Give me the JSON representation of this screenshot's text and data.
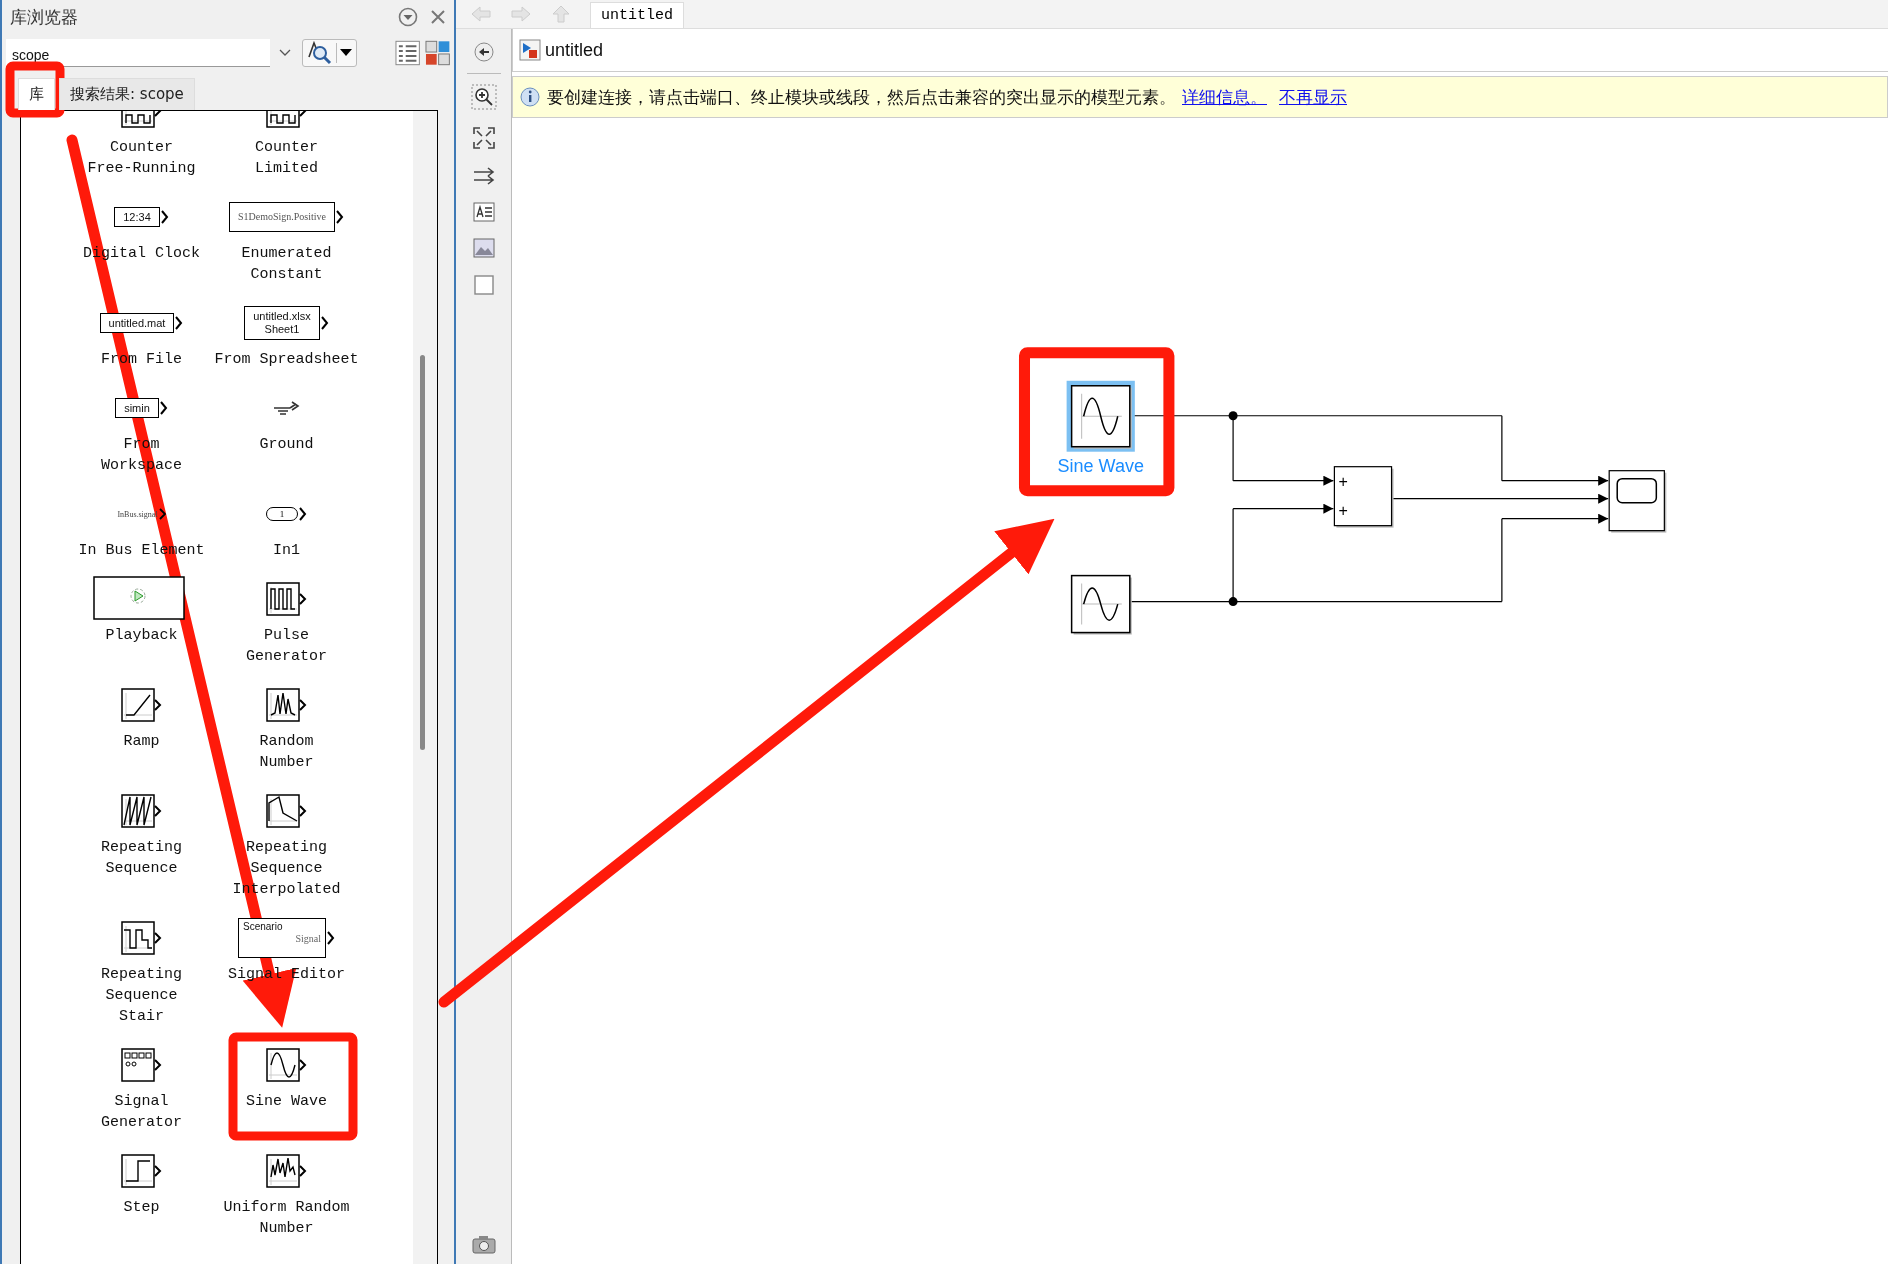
{
  "library_browser": {
    "title": "库浏览器",
    "search": {
      "value": "scope"
    },
    "tabs": [
      {
        "label": "库",
        "selected": true
      },
      {
        "label": "搜索结果: scope",
        "selected": false
      }
    ],
    "blocks": [
      {
        "label": "Counter\nFree-Running",
        "icon": {
          "kind": "counter"
        }
      },
      {
        "label": "Counter\nLimited",
        "icon": {
          "kind": "counter"
        }
      },
      {
        "label": "Digital Clock",
        "icon": {
          "kind": "text",
          "lines": [
            "12:34"
          ]
        }
      },
      {
        "label": "Enumerated\nConstant",
        "icon": {
          "kind": "serif-text",
          "lines": [
            "S1DemoSign.Positive"
          ]
        }
      },
      {
        "label": "From File",
        "icon": {
          "kind": "text",
          "lines": [
            "untitled.mat"
          ]
        }
      },
      {
        "label": "From Spreadsheet",
        "icon": {
          "kind": "text",
          "lines": [
            "untitled.xlsx",
            "Sheet1"
          ]
        }
      },
      {
        "label": "From\nWorkspace",
        "icon": {
          "kind": "text",
          "lines": [
            "simin"
          ]
        }
      },
      {
        "label": "Ground",
        "icon": {
          "kind": "ground"
        }
      },
      {
        "label": "In Bus Element",
        "icon": {
          "kind": "bus",
          "lines": [
            "InBus.signal"
          ]
        }
      },
      {
        "label": "In1",
        "icon": {
          "kind": "inport",
          "lines": [
            "1"
          ]
        }
      },
      {
        "label": "Playback",
        "icon": {
          "kind": "playback"
        }
      },
      {
        "label": "Pulse\nGenerator",
        "icon": {
          "kind": "pulse"
        }
      },
      {
        "label": "Ramp",
        "icon": {
          "kind": "ramp"
        }
      },
      {
        "label": "Random\nNumber",
        "icon": {
          "kind": "random"
        }
      },
      {
        "label": "Repeating\nSequence",
        "icon": {
          "kind": "sawtooth"
        }
      },
      {
        "label": "Repeating\nSequence\nInterpolated",
        "icon": {
          "kind": "interp"
        }
      },
      {
        "label": "Repeating\nSequence\nStair",
        "icon": {
          "kind": "stair"
        }
      },
      {
        "label": "Signal Editor",
        "icon": {
          "kind": "scenario",
          "lines": [
            "Scenario",
            "Signal"
          ]
        }
      },
      {
        "label": "Signal\nGenerator",
        "icon": {
          "kind": "siggen"
        }
      },
      {
        "label": "Sine Wave",
        "icon": {
          "kind": "sine"
        }
      },
      {
        "label": "Step",
        "icon": {
          "kind": "step"
        }
      },
      {
        "label": "Uniform Random\nNumber",
        "icon": {
          "kind": "uniform"
        }
      }
    ]
  },
  "editor": {
    "tab": "untitled",
    "address": "untitled",
    "info": {
      "message": "要创建连接，请点击端口、终止模块或线段，然后点击兼容的突出显示的模型元素。",
      "links": [
        "详细信息。",
        "不再显示"
      ]
    },
    "blocks": [
      {
        "kind": "sine",
        "label": "Sine Wave",
        "selected": true
      },
      {
        "kind": "sine",
        "selected": false
      },
      {
        "kind": "sum",
        "signs": [
          "+",
          "+"
        ]
      },
      {
        "kind": "scope"
      }
    ]
  }
}
